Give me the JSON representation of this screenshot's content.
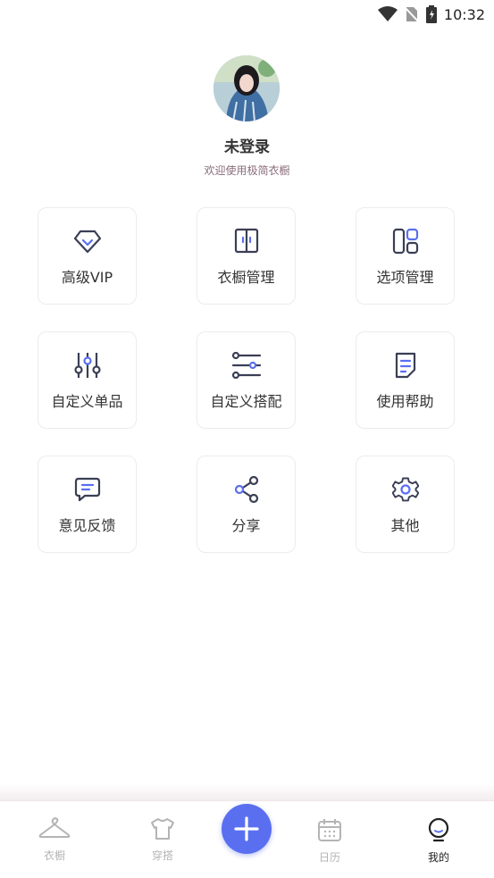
{
  "status_bar": {
    "time": "10:32"
  },
  "profile": {
    "name": "未登录",
    "subtitle": "欢迎使用极简衣橱"
  },
  "menu": [
    {
      "label": "高级VIP",
      "icon": "diamond-icon"
    },
    {
      "label": "衣橱管理",
      "icon": "wardrobe-icon"
    },
    {
      "label": "选项管理",
      "icon": "layout-icon"
    },
    {
      "label": "自定义单品",
      "icon": "sliders-icon"
    },
    {
      "label": "自定义搭配",
      "icon": "filter-lines-icon"
    },
    {
      "label": "使用帮助",
      "icon": "document-icon"
    },
    {
      "label": "意见反馈",
      "icon": "message-icon"
    },
    {
      "label": "分享",
      "icon": "share-icon"
    },
    {
      "label": "其他",
      "icon": "gear-icon"
    }
  ],
  "tabs": [
    {
      "label": "衣橱",
      "icon": "hanger-icon",
      "active": false
    },
    {
      "label": "穿搭",
      "icon": "shirt-icon",
      "active": false
    },
    {
      "label": "日历",
      "icon": "calendar-icon",
      "active": false
    },
    {
      "label": "我的",
      "icon": "profile-icon",
      "active": true
    }
  ],
  "colors": {
    "accent": "#5a6ff0",
    "icon_stroke": "#3a3f55",
    "inactive": "#b4b4b4"
  }
}
